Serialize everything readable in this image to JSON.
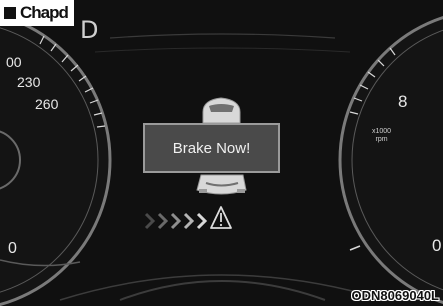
{
  "header_label": "Chapd",
  "gear_indicator": "D",
  "speedometer": {
    "visible_marks": [
      "00",
      "230",
      "260"
    ],
    "bottom_mark": "0"
  },
  "tachometer": {
    "mark": "8",
    "unit_line1": "x1000",
    "unit_line2": "rpm",
    "bottom_mark": "0"
  },
  "alert": {
    "message": "Brake Now!",
    "icon": "warning-triangle-icon",
    "chevron_icon": "forward-chevrons-icon"
  },
  "figure_code": "ODN8069040L",
  "colors": {
    "background": "#101010",
    "alert_box": "#4a4a4a",
    "alert_border": "#9a9a9a",
    "text": "#e8e8e8"
  }
}
